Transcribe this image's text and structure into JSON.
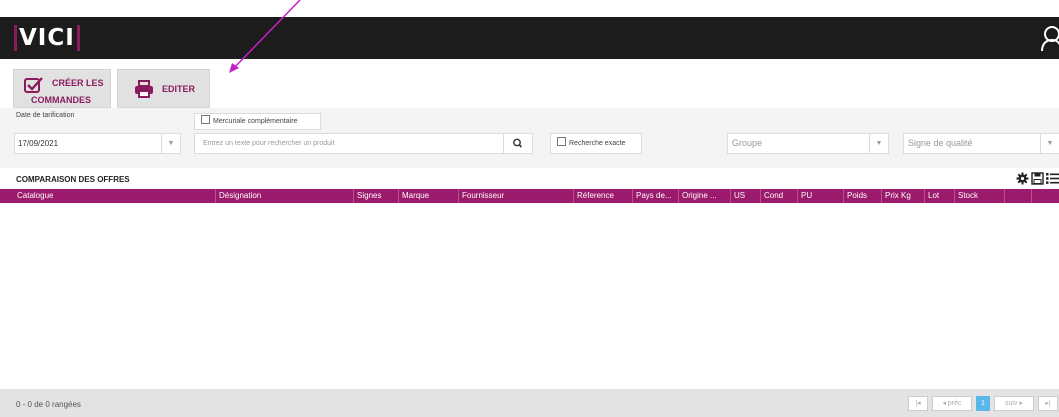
{
  "header": {
    "logo": "VICI",
    "user_icon": "user-icon"
  },
  "toolbar": {
    "creer_line1": "CRÉER LES",
    "creer_line2": "COMMANDES",
    "editer": "EDITER"
  },
  "filters": {
    "date_label": "Date de tarification",
    "date_value": "17/09/2021",
    "mercuriale_label": "Mercuriale complémentaire",
    "search_placeholder": "Entrez un texte pour rechercher un produit",
    "exact_label": "Recherche exacte",
    "groupe_placeholder": "Groupe",
    "signe_placeholder": "Signe de qualité"
  },
  "section": {
    "title": "COMPARAISON DES OFFRES"
  },
  "grid": {
    "columns": [
      "Catalogue",
      "Désignation",
      "Signes",
      "Marque",
      "Fournisseur",
      "Réference",
      "Pays de...",
      "Origine ...",
      "US",
      "Cond",
      "PU",
      "Poids",
      "Prix Kg",
      "Lot",
      "Stock"
    ],
    "rows": []
  },
  "footer": {
    "info": "0 - 0 de 0 rangées",
    "first": "|◂",
    "prev": "◂ préc",
    "page": "1",
    "next": "suiv ▸",
    "last": "▸|"
  },
  "colors": {
    "accent": "#9c1a6b",
    "topbar": "#1c1c1c",
    "page_active": "#59b8e8"
  }
}
